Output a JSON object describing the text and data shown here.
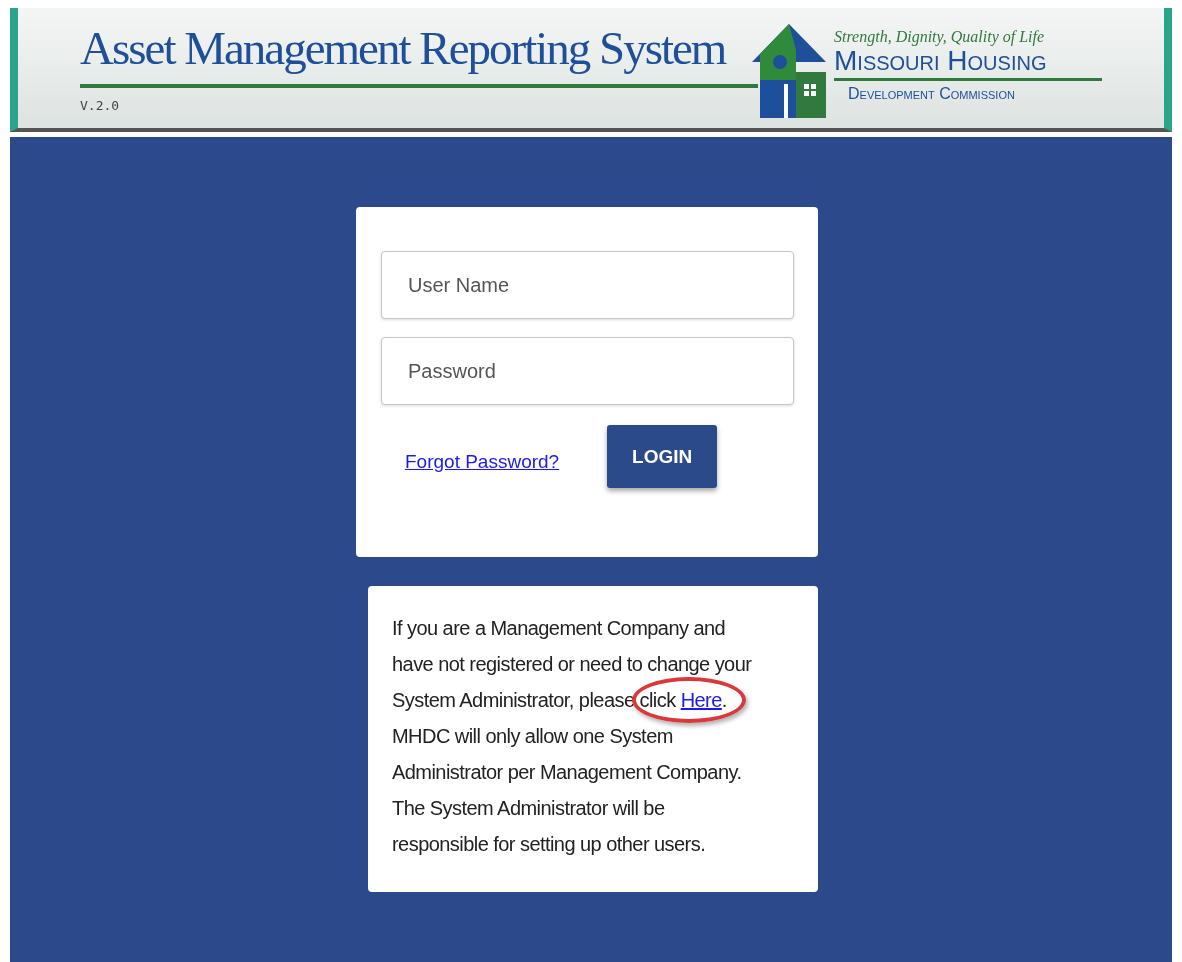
{
  "header": {
    "title": "Asset Management Reporting System",
    "version": "V.2.0",
    "logo": {
      "tagline": "Strength, Dignity, Quality of Life",
      "name_line_1": "Missouri Housing",
      "name_line_2": "Development Commission"
    }
  },
  "login": {
    "username": {
      "placeholder": "User Name"
    },
    "password": {
      "placeholder": "Password"
    },
    "forgot_link": "Forgot Password?",
    "login_button": "LOGIN"
  },
  "info": {
    "text_before": "If you are a Management Company and have not registered or need to change your System Administrator, please click ",
    "link": "Here",
    "text_after": ". MHDC will only allow one System Administrator per Management Company. The System Administrator will be responsible for setting up other users.",
    "link_highlighted": true
  }
}
